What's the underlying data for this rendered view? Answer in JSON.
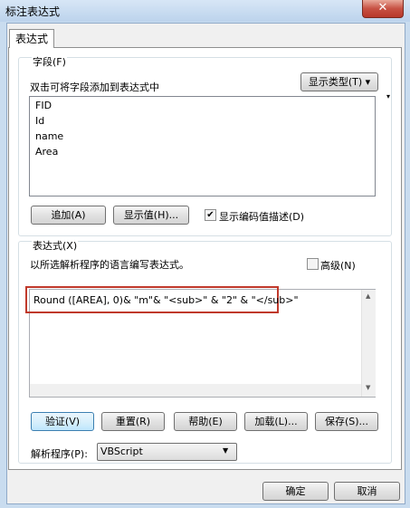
{
  "window": {
    "title": "标注表达式",
    "close_glyph": "✕"
  },
  "tab": {
    "label": "表达式"
  },
  "fields_group": {
    "legend": "字段(F)",
    "instruction": "双击可将字段添加到表达式中",
    "show_types_button": "显示类型(T) ▾",
    "fields": [
      "FID",
      "Id",
      "name",
      "Area"
    ],
    "add_button": "追加(A)",
    "show_values_button": "显示值(H)...",
    "show_coded_desc_checked": true,
    "show_coded_desc_label": "显示编码值描述(D)"
  },
  "expression_group": {
    "legend": "表达式(X)",
    "instruction": "以所选解析程序的语言编写表达式。",
    "advanced_checked": false,
    "advanced_label": "高级(N)",
    "expression_text": "Round ([AREA], 0)& \"m\"& \"<sub>\" & \"2\" & \"</sub>\"",
    "highlight_color": "#c0392b"
  },
  "action_buttons": {
    "verify": "验证(V)",
    "reset": "重置(R)",
    "help": "帮助(E)",
    "load": "加载(L)...",
    "save": "保存(S)..."
  },
  "parser": {
    "label": "解析程序(P):",
    "value": "VBScript"
  },
  "dialog_buttons": {
    "ok": "确定",
    "cancel": "取消"
  }
}
